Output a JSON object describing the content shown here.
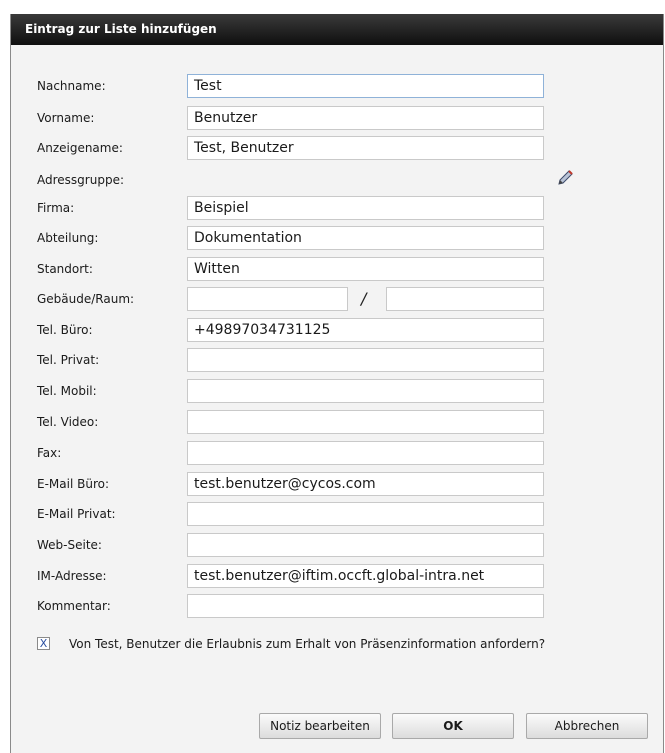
{
  "dialog": {
    "title": "Eintrag zur Liste hinzufügen"
  },
  "form": {
    "nachname": {
      "label": "Nachname:",
      "value": "Test"
    },
    "vorname": {
      "label": "Vorname:",
      "value": "Benutzer"
    },
    "anzeigename": {
      "label": "Anzeigename:",
      "value": "Test, Benutzer"
    },
    "adressgruppe": {
      "label": "Adressgruppe:",
      "edit_icon": "pencil-icon"
    },
    "firma": {
      "label": "Firma:",
      "value": "Beispiel"
    },
    "abteilung": {
      "label": "Abteilung:",
      "value": "Dokumentation"
    },
    "standort": {
      "label": "Standort:",
      "value": "Witten"
    },
    "gebaeude_raum": {
      "label": "Gebäude/Raum:",
      "gebaeude": "",
      "separator": "/",
      "raum": ""
    },
    "tel_buero": {
      "label": "Tel. Büro:",
      "value": "+49897034731125"
    },
    "tel_privat": {
      "label": "Tel. Privat:",
      "value": ""
    },
    "tel_mobil": {
      "label": "Tel. Mobil:",
      "value": ""
    },
    "tel_video": {
      "label": "Tel. Video:",
      "value": ""
    },
    "fax": {
      "label": "Fax:",
      "value": ""
    },
    "email_buero": {
      "label": "E-Mail Büro:",
      "value": "test.benutzer@cycos.com"
    },
    "email_privat": {
      "label": "E-Mail Privat:",
      "value": ""
    },
    "webseite": {
      "label": "Web-Seite:",
      "value": ""
    },
    "im_adresse": {
      "label": "IM-Adresse:",
      "value": "test.benutzer@iftim.occft.global-intra.net"
    },
    "kommentar": {
      "label": "Kommentar:",
      "value": ""
    }
  },
  "presence_request": {
    "checked": true,
    "mark": "X",
    "label": "Von Test, Benutzer die Erlaubnis zum Erhalt von Präsenzinformation anfordern?"
  },
  "buttons": {
    "notiz": "Notiz bearbeiten",
    "ok": "OK",
    "abbrechen": "Abbrechen"
  }
}
